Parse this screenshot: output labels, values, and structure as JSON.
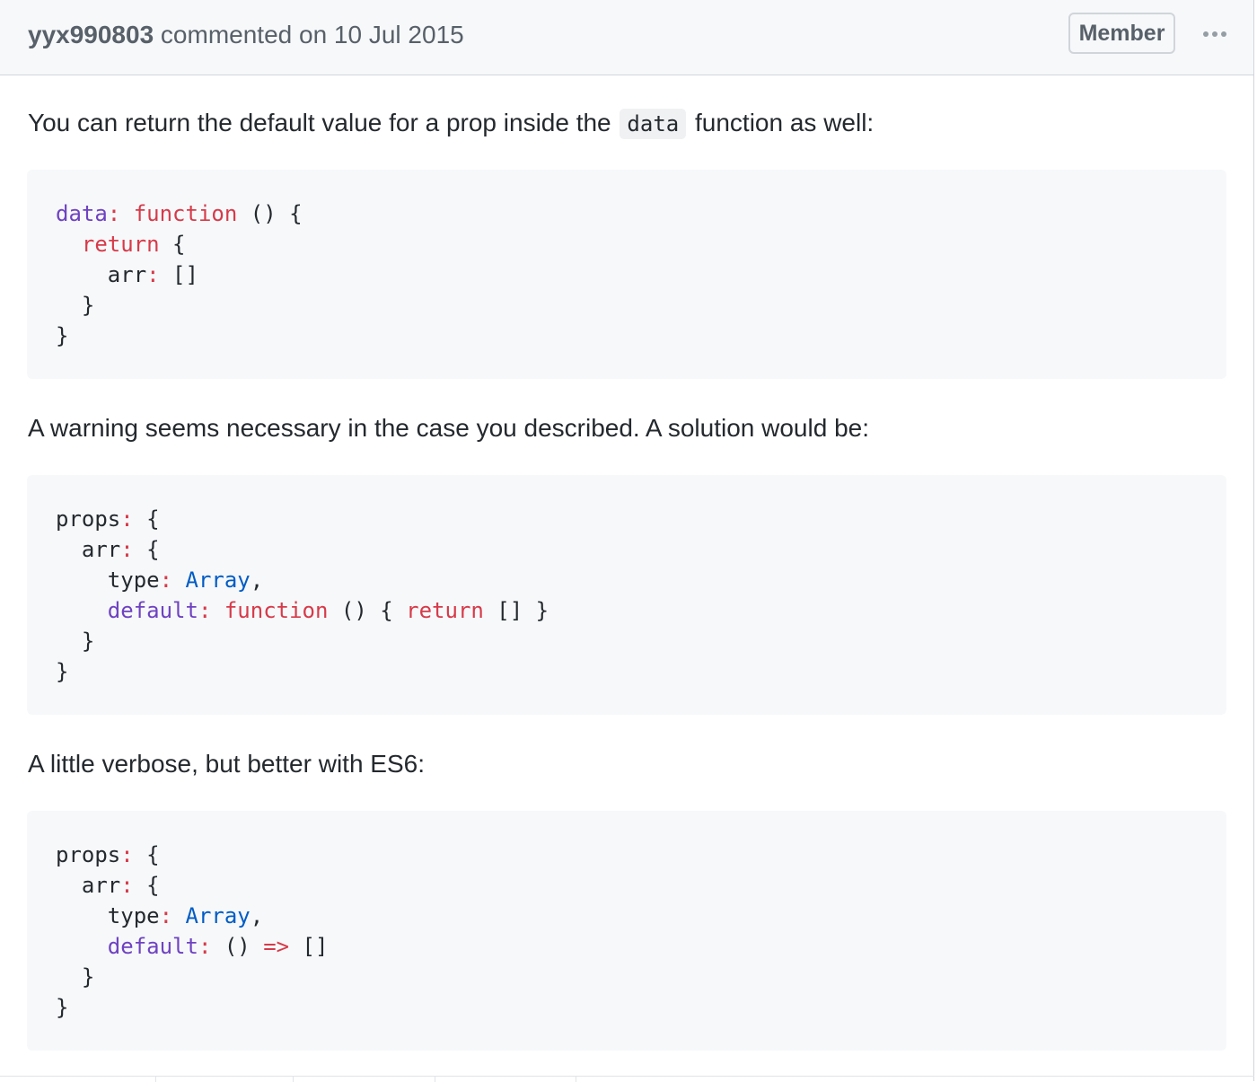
{
  "comment": {
    "author": "yyx990803",
    "action_text": " commented on 10 Jul 2015",
    "badge": "Member",
    "more_icon": "kebab-horizontal-icon",
    "paragraphs": [
      {
        "before": "You can return the default value for a prop inside the ",
        "code": "data",
        "after": " function as well:"
      },
      {
        "text": "A warning seems necessary in the case you described. A solution would be:"
      },
      {
        "text": "A little verbose, but better with ES6:"
      }
    ],
    "code_blocks": [
      {
        "lines": [
          [
            [
              "prop",
              "data"
            ],
            [
              "keyword",
              ":"
            ],
            [
              "plain",
              " "
            ],
            [
              "keyword",
              "function"
            ],
            [
              "plain",
              " () {"
            ]
          ],
          [
            [
              "plain",
              "  "
            ],
            [
              "keyword",
              "return"
            ],
            [
              "plain",
              " {"
            ]
          ],
          [
            [
              "plain",
              "    arr"
            ],
            [
              "keyword",
              ":"
            ],
            [
              "plain",
              " []"
            ]
          ],
          [
            [
              "plain",
              "  }"
            ]
          ],
          [
            [
              "plain",
              "}"
            ]
          ]
        ]
      },
      {
        "lines": [
          [
            [
              "plain",
              "props"
            ],
            [
              "keyword",
              ":"
            ],
            [
              "plain",
              " {"
            ]
          ],
          [
            [
              "plain",
              "  arr"
            ],
            [
              "keyword",
              ":"
            ],
            [
              "plain",
              " {"
            ]
          ],
          [
            [
              "plain",
              "    type"
            ],
            [
              "keyword",
              ":"
            ],
            [
              "plain",
              " "
            ],
            [
              "builtin",
              "Array"
            ],
            [
              "plain",
              ","
            ]
          ],
          [
            [
              "plain",
              "    "
            ],
            [
              "prop",
              "default"
            ],
            [
              "keyword",
              ":"
            ],
            [
              "plain",
              " "
            ],
            [
              "keyword",
              "function"
            ],
            [
              "plain",
              " () { "
            ],
            [
              "keyword",
              "return"
            ],
            [
              "plain",
              " [] }"
            ]
          ],
          [
            [
              "plain",
              "  }"
            ]
          ],
          [
            [
              "plain",
              "}"
            ]
          ]
        ]
      },
      {
        "lines": [
          [
            [
              "plain",
              "props"
            ],
            [
              "keyword",
              ":"
            ],
            [
              "plain",
              " {"
            ]
          ],
          [
            [
              "plain",
              "  arr"
            ],
            [
              "keyword",
              ":"
            ],
            [
              "plain",
              " {"
            ]
          ],
          [
            [
              "plain",
              "    type"
            ],
            [
              "keyword",
              ":"
            ],
            [
              "plain",
              " "
            ],
            [
              "builtin",
              "Array"
            ],
            [
              "plain",
              ","
            ]
          ],
          [
            [
              "plain",
              "    "
            ],
            [
              "prop",
              "default"
            ],
            [
              "keyword",
              ":"
            ],
            [
              "plain",
              " () "
            ],
            [
              "keyword",
              "=>"
            ],
            [
              "plain",
              " []"
            ]
          ],
          [
            [
              "plain",
              "  }"
            ]
          ],
          [
            [
              "plain",
              "}"
            ]
          ]
        ]
      }
    ]
  },
  "colors": {
    "header_bg": "#f6f8fa",
    "border": "#d1d5da",
    "code_bg": "#f6f8fa",
    "keyword": "#d73a49",
    "property": "#6f42c1",
    "builtin": "#005cc5",
    "text": "#24292e",
    "muted": "#586069"
  }
}
